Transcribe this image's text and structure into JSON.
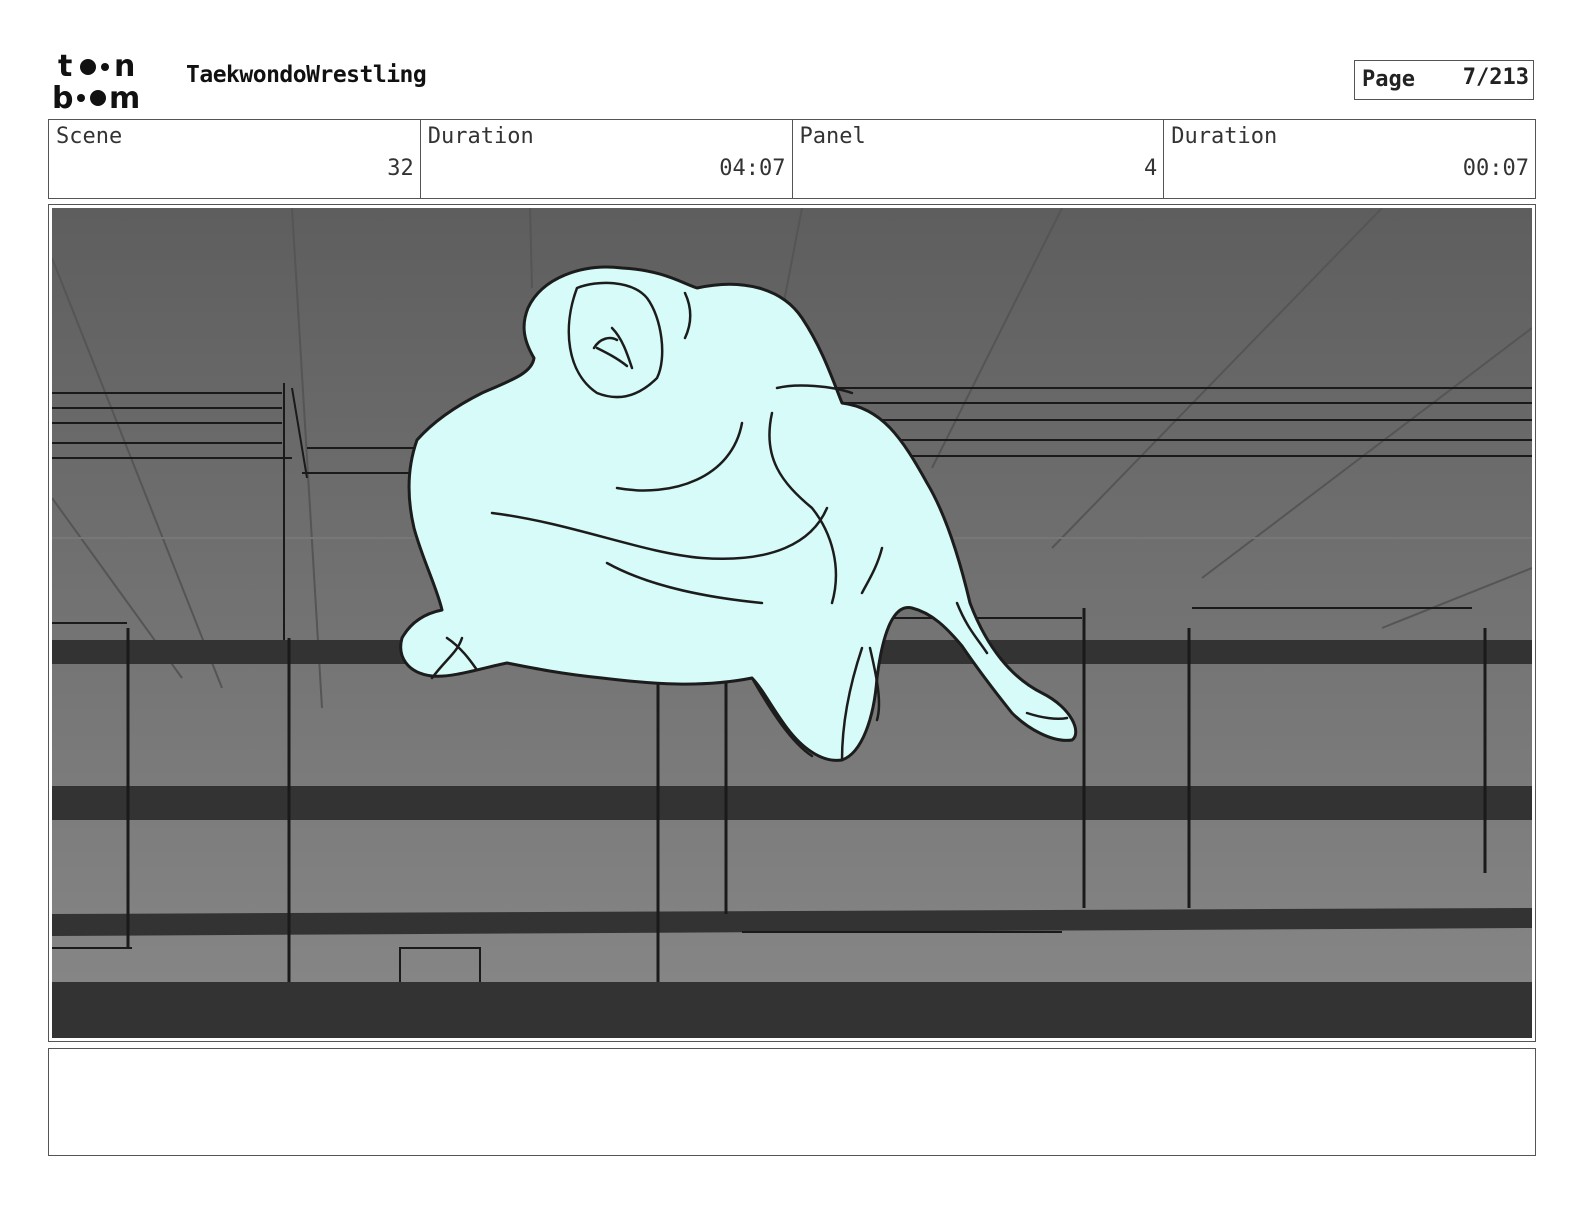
{
  "header": {
    "logo_text": "toon boom",
    "project_title": "TaekwondoWrestling",
    "page_label": "Page",
    "page_value": "7/213"
  },
  "info": {
    "scene_label": "Scene",
    "scene_value": "32",
    "scene_duration_label": "Duration",
    "scene_duration_value": "04:07",
    "panel_label": "Panel",
    "panel_value": "4",
    "panel_duration_label": "Duration",
    "panel_duration_value": "00:07"
  },
  "panel": {
    "figure_color": "#d6fbf8",
    "background_color": "#6e6e6e",
    "rail_color": "#333333"
  },
  "notes": {
    "text": ""
  }
}
